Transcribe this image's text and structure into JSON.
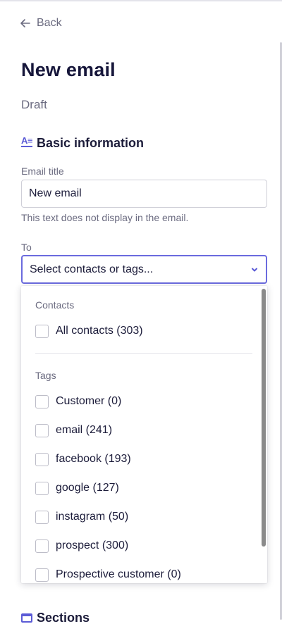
{
  "nav": {
    "back_label": "Back"
  },
  "header": {
    "title": "New email",
    "status": "Draft"
  },
  "basic_info": {
    "heading": "Basic information",
    "email_title_label": "Email title",
    "email_title_value": "New email",
    "email_title_help": "This text does not display in the email.",
    "to_label": "To",
    "to_placeholder": "Select contacts or tags..."
  },
  "dropdown": {
    "contacts_label": "Contacts",
    "contacts": [
      {
        "label": "All contacts (303)",
        "checked": false
      }
    ],
    "tags_label": "Tags",
    "tags": [
      {
        "label": "Customer (0)",
        "checked": false
      },
      {
        "label": "email (241)",
        "checked": false
      },
      {
        "label": "facebook (193)",
        "checked": false
      },
      {
        "label": "google (127)",
        "checked": false
      },
      {
        "label": "instagram (50)",
        "checked": false
      },
      {
        "label": "prospect (300)",
        "checked": false
      },
      {
        "label": "Prospective customer (0)",
        "checked": false
      }
    ]
  },
  "sections": {
    "heading": "Sections"
  },
  "colors": {
    "accent": "#5b5bd6",
    "text": "#1c1c3a",
    "muted": "#6b6b80",
    "border": "#cfcfd8"
  }
}
